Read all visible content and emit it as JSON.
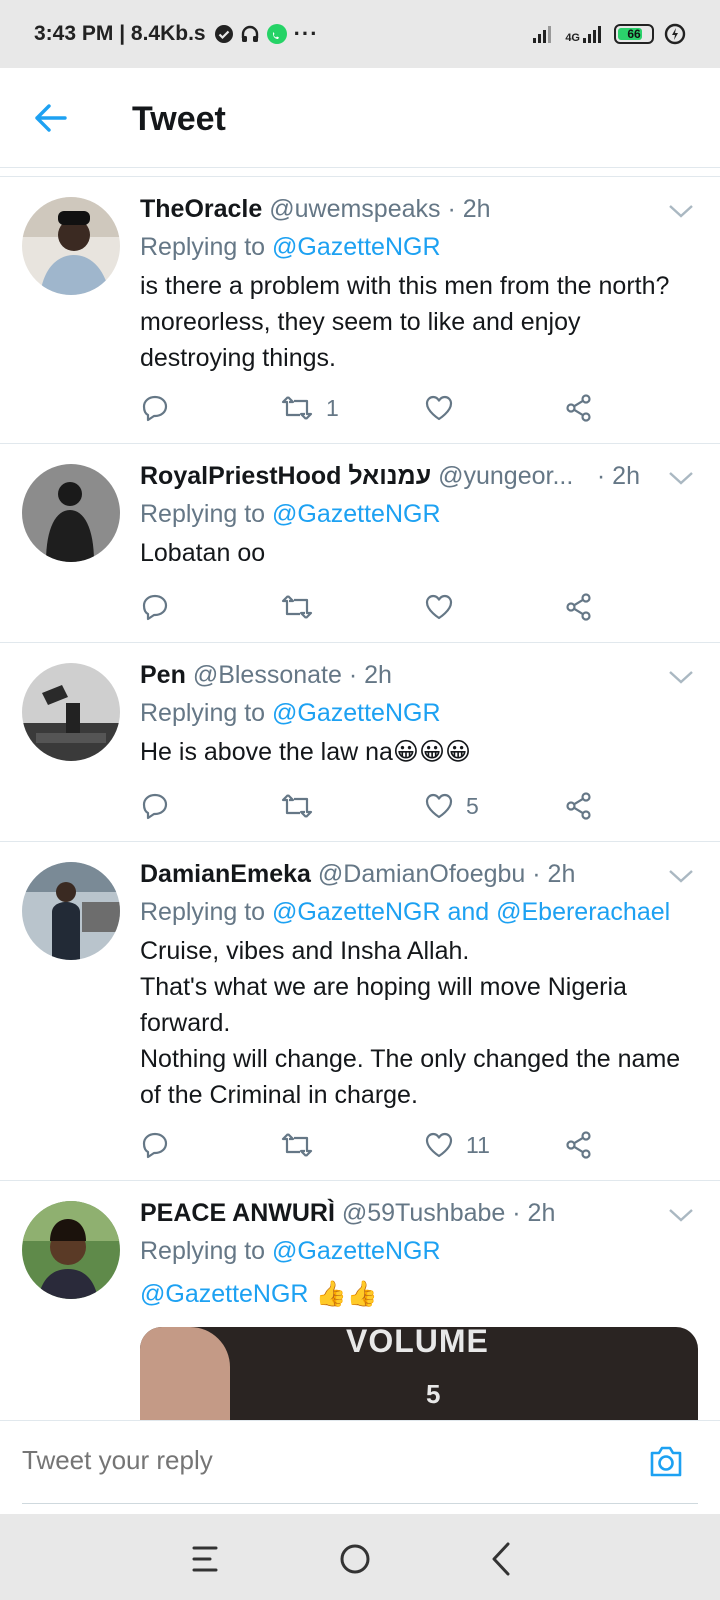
{
  "status_bar": {
    "time_speed": "3:43 PM | 8.4Kb.s",
    "network": "4G",
    "battery": "66"
  },
  "header": {
    "title": "Tweet"
  },
  "tweets": [
    {
      "name": "TheOracle",
      "meta": "@uwemspeaks · 2h",
      "replying_prefix": "Replying to",
      "replying_to": "@GazetteNGR",
      "body": "is there a problem with this men from the north? moreorless, they seem to like and enjoy destroying things.",
      "retweets": "1",
      "likes": ""
    },
    {
      "name": "RoyalPriestHood עמנואל",
      "meta": "@yungeor...",
      "time": "· 2h",
      "replying_prefix": "Replying to",
      "replying_to": "@GazetteNGR",
      "body": "Lobatan oo",
      "retweets": "",
      "likes": ""
    },
    {
      "name": "Pen",
      "meta": "@Blessonate · 2h",
      "replying_prefix": "Replying to",
      "replying_to": "@GazetteNGR",
      "body": "He is above the law na😀😀😀",
      "retweets": "",
      "likes": "5"
    },
    {
      "name": "DamianEmeka",
      "meta": "@DamianOfoegbu · 2h",
      "replying_prefix": "Replying to",
      "replying_to": "@GazetteNGR and @Ebererachael",
      "body_lines": [
        "Cruise, vibes and Insha Allah.",
        "That's what we are hoping will move Nigeria forward.",
        "Nothing will change. The only changed the name of the Criminal in charge."
      ],
      "retweets": "",
      "likes": "11"
    },
    {
      "name": "PEACE ANWURÌ",
      "meta": "@59Tushbabe · 2h",
      "replying_prefix": "Replying to",
      "replying_to": "@GazetteNGR",
      "body_mention": "@GazetteNGR",
      "body_emoji": "👍👍",
      "media_text": "VOLUME"
    }
  ],
  "reply_bar": {
    "placeholder": "Tweet your reply"
  },
  "colors": {
    "accent": "#1da1f2",
    "muted": "#657786",
    "text": "#14171a",
    "divider": "#e1e8ed"
  },
  "icons": [
    "back-arrow-icon",
    "caret-down-icon",
    "reply-icon",
    "retweet-icon",
    "like-icon",
    "share-icon",
    "camera-icon",
    "menu-icon",
    "home-circle-icon",
    "back-chevron-icon"
  ]
}
